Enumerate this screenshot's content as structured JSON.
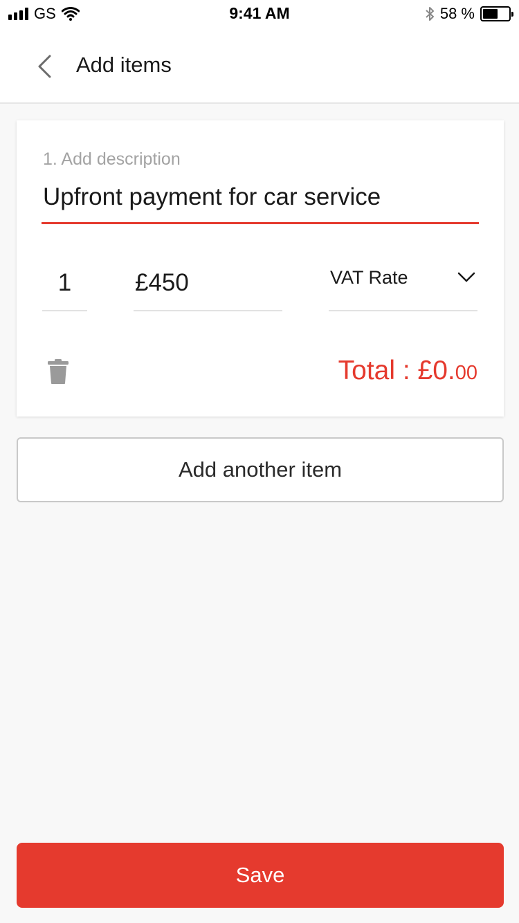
{
  "status_bar": {
    "carrier": "GS",
    "time": "9:41 AM",
    "battery_percent": "58 %",
    "battery_level": 0.58,
    "icons": [
      "signal-icon",
      "wifi-icon",
      "bluetooth-icon",
      "battery-icon"
    ]
  },
  "nav": {
    "title": "Add items",
    "back_icon": "chevron-left-icon"
  },
  "item": {
    "description_label": "1. Add description",
    "description_value": "Upfront payment for car service",
    "quantity": "1",
    "price": "£450",
    "vat_label": "VAT Rate",
    "vat_icon": "chevron-down-icon",
    "delete_icon": "trash-icon",
    "total_label": "Total : £0.",
    "total_decimals": "00"
  },
  "actions": {
    "add_another": "Add another item",
    "save": "Save"
  },
  "colors": {
    "accent": "#e53a2e",
    "background": "#f8f8f8",
    "card": "#ffffff",
    "muted_text": "#a3a3a3"
  }
}
